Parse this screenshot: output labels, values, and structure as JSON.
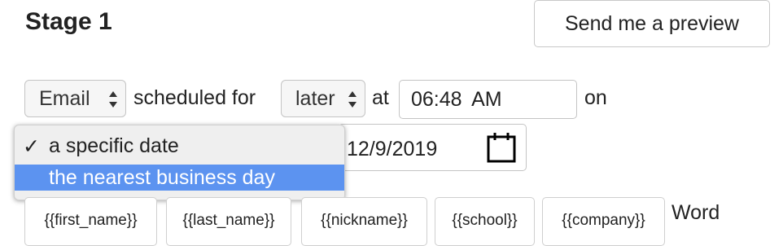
{
  "header": {
    "title": "Stage 1",
    "preview_button": "Send me a preview"
  },
  "schedule": {
    "channel_value": "Email",
    "scheduled_for_text": "scheduled for",
    "timing_value": "later",
    "at_text": "at",
    "time_value": "06:48 AM",
    "on_text": "on",
    "date_value": "12/9/2019"
  },
  "date_mode_dropdown": {
    "options": [
      {
        "label": "a specific date",
        "checked": true
      },
      {
        "label": "the nearest business day",
        "highlighted": true
      }
    ],
    "check_glyph": "✓",
    "highlight_color": "#5c93f0"
  },
  "merge_tags": [
    "{{first_name}}",
    "{{last_name}}",
    "{{nickname}}",
    "{{school}}",
    "{{company}}"
  ],
  "word_label": "Word",
  "icons": [
    "select-arrows-icon",
    "calendar-icon",
    "checkmark-icon"
  ]
}
